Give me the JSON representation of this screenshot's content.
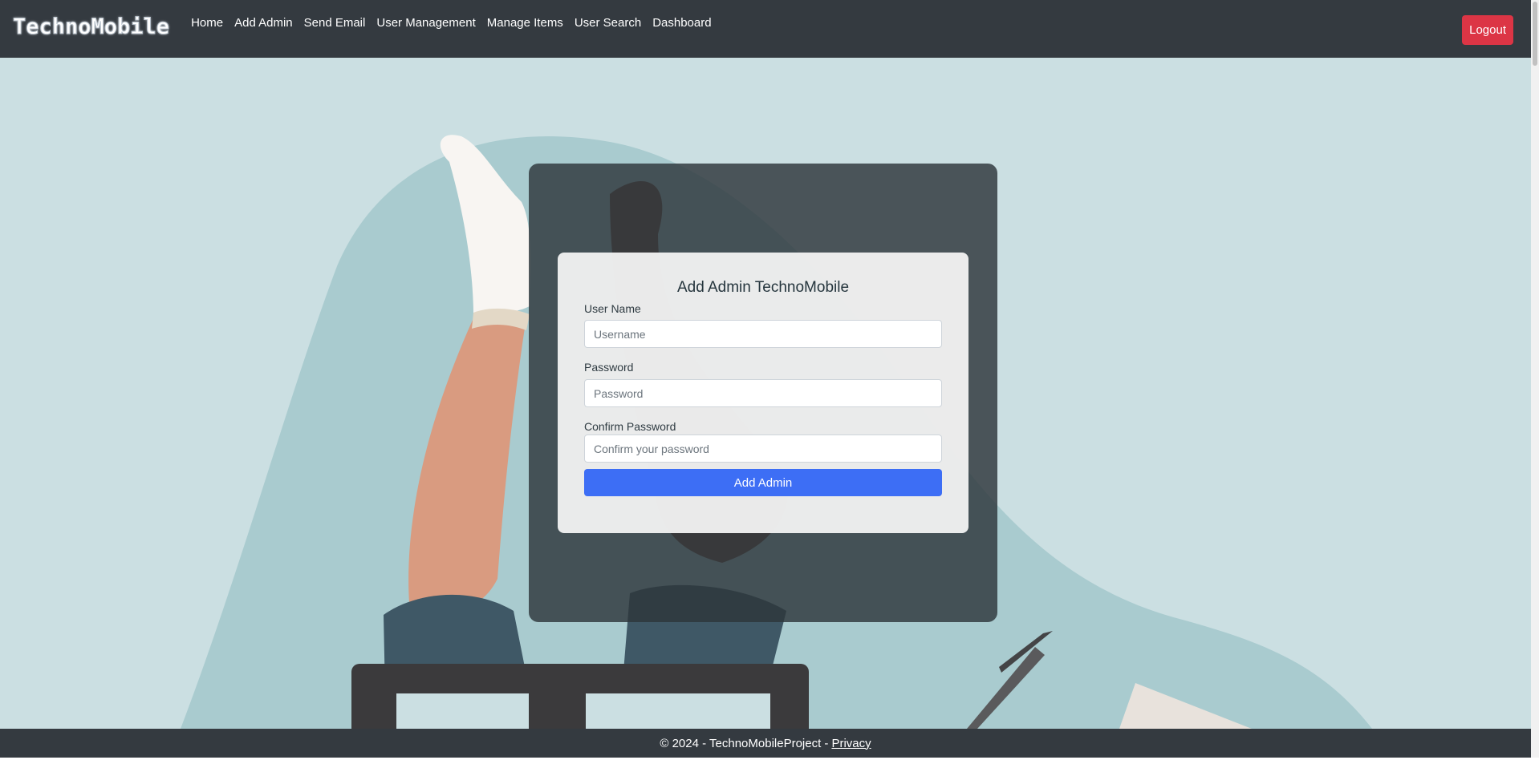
{
  "navbar": {
    "brand": "TechnoMobile",
    "links": [
      "Home",
      "Add Admin",
      "Send Email",
      "User Management",
      "Manage Items",
      "User Search",
      "Dashboard"
    ],
    "logout_label": "Logout"
  },
  "form": {
    "title": "Add Admin TechnoMobile",
    "username": {
      "label": "User Name",
      "placeholder": "Username",
      "value": ""
    },
    "password": {
      "label": "Password",
      "placeholder": "Password",
      "value": ""
    },
    "confirm": {
      "label": "Confirm Password",
      "placeholder": "Confirm your password",
      "value": ""
    },
    "submit_label": "Add Admin"
  },
  "footer": {
    "text": "© 2024 - TechnoMobileProject -",
    "privacy_label": "Privacy"
  },
  "colors": {
    "navbar": "#343a40",
    "logout": "#dc3545",
    "primary": "#3d6ef5",
    "background": "#cbdfe2"
  },
  "icons": {
    "illustration": "person-lying-with-laptop-illustration"
  }
}
